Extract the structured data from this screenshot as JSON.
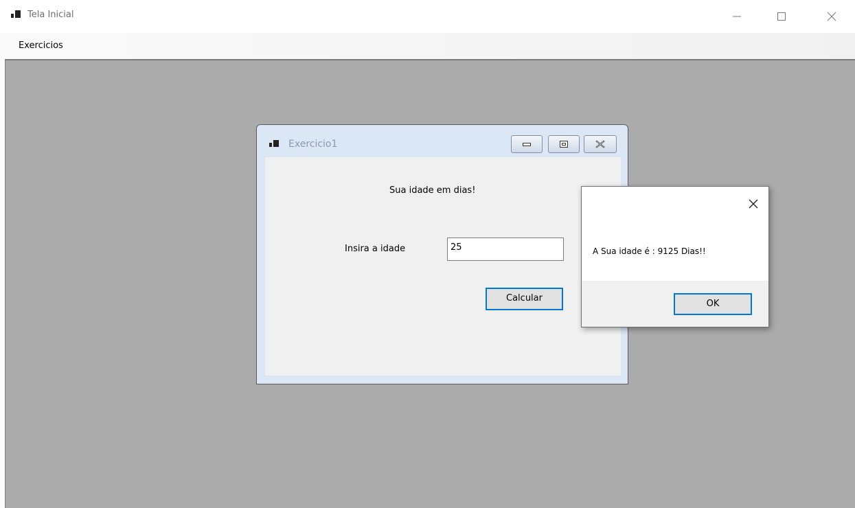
{
  "window": {
    "title": "Tela Inicial",
    "icons": {
      "app": "app-window-icon",
      "minimize": "minimize-icon",
      "maximize": "maximize-icon",
      "close": "close-icon"
    }
  },
  "menu": {
    "items": [
      {
        "label": "Exercicios"
      }
    ]
  },
  "child_window": {
    "title": "Exercicio1",
    "heading": "Sua idade em dias!",
    "input_label": "Insira a idade",
    "age_value": "25",
    "calculate_label": "Calcular"
  },
  "message_box": {
    "text": "A Sua idade é : 9125 Dias!!",
    "ok_label": "OK"
  },
  "colors": {
    "mdi_background": "#ababab",
    "focus_accent": "#0078d7",
    "dialog_surface": "#f0f0f0"
  }
}
